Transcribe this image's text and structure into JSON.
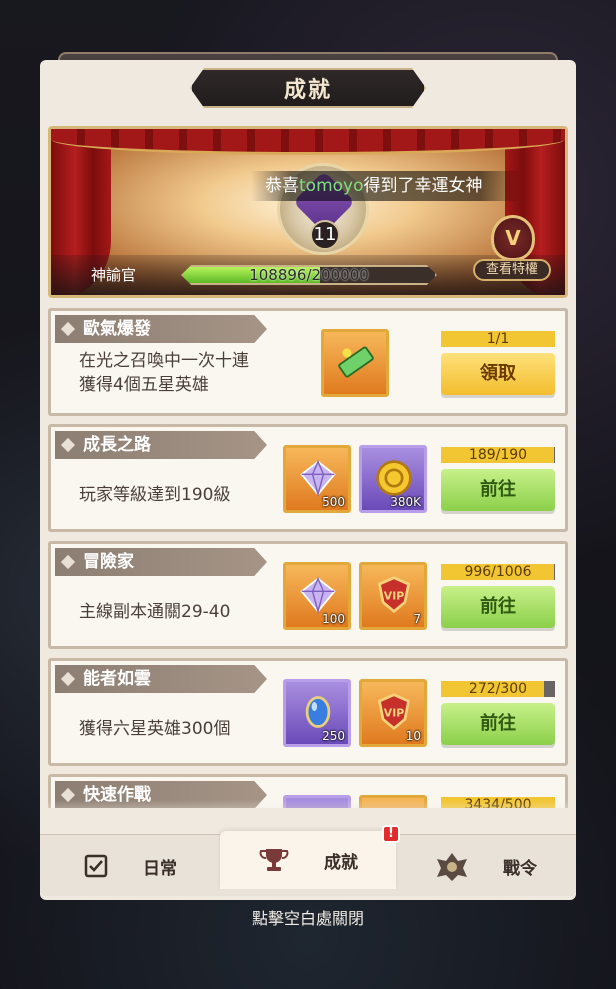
{
  "header": {
    "title": "成就"
  },
  "banner": {
    "ticker_prefix": "恭喜",
    "ticker_player": "tomoyo",
    "ticker_suffix": "得到了幸運女神",
    "emblem_level": "11",
    "rank_name": "神諭官",
    "xp_text": "108896/200000",
    "xp_fraction": 0.544,
    "privilege_label": "查看特權",
    "privilege_glyph": "V"
  },
  "achievements": [
    {
      "title": "歐氣爆發",
      "desc_lines": [
        "在光之召喚中一次十連",
        "獲得4個五星英雄"
      ],
      "rewards": [
        {
          "icon": "ticket-icon",
          "frame": "orange",
          "qty": ""
        }
      ],
      "progress_text": "1/1",
      "progress_fraction": 1.0,
      "action": "領取",
      "action_style": "yellow"
    },
    {
      "title": "成長之路",
      "desc_lines": [
        "玩家等級達到190級"
      ],
      "rewards": [
        {
          "icon": "diamond-icon",
          "frame": "orange",
          "qty": "500"
        },
        {
          "icon": "gold-coin-icon",
          "frame": "purple",
          "qty": "380K"
        }
      ],
      "progress_text": "189/190",
      "progress_fraction": 0.995,
      "action": "前往",
      "action_style": "green"
    },
    {
      "title": "冒險家",
      "desc_lines": [
        "主線副本通關29-40"
      ],
      "rewards": [
        {
          "icon": "diamond-icon",
          "frame": "orange",
          "qty": "100"
        },
        {
          "icon": "vip-badge-icon",
          "frame": "orange",
          "qty": "7"
        }
      ],
      "progress_text": "996/1006",
      "progress_fraction": 0.99,
      "action": "前往",
      "action_style": "green"
    },
    {
      "title": "能者如雲",
      "desc_lines": [
        "獲得六星英雄300個"
      ],
      "rewards": [
        {
          "icon": "blue-gem-icon",
          "frame": "purple",
          "qty": "250"
        },
        {
          "icon": "vip-badge-icon",
          "frame": "orange",
          "qty": "10"
        }
      ],
      "progress_text": "272/300",
      "progress_fraction": 0.907,
      "action": "前往",
      "action_style": "green"
    },
    {
      "title": "快速作戰",
      "desc_lines": [
        ""
      ],
      "rewards": [
        {
          "icon": "reward-icon",
          "frame": "purple",
          "qty": ""
        },
        {
          "icon": "reward-icon",
          "frame": "orange",
          "qty": ""
        }
      ],
      "progress_text": "3434/500",
      "progress_fraction": 1.0,
      "action": "",
      "action_style": "green"
    }
  ],
  "tabs": [
    {
      "label": "日常",
      "icon": "checklist-icon",
      "active": false
    },
    {
      "label": "成就",
      "icon": "trophy-icon",
      "active": true,
      "badge": "!"
    },
    {
      "label": "戰令",
      "icon": "crest-icon",
      "active": false
    }
  ],
  "close_hint": "點擊空白處關閉",
  "colors": {
    "panel_bg": "#efe9df",
    "progress_fill": "#f2c533",
    "claim_button": "#f3bd2d",
    "go_button": "#8bd04a",
    "alert": "#e22b2b",
    "highlight_name": "#7fe07a"
  }
}
